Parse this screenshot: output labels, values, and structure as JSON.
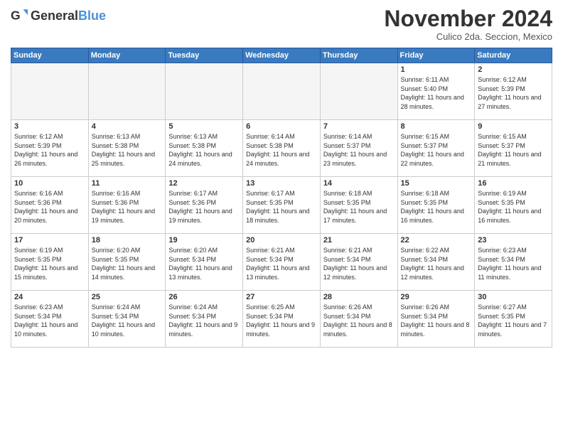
{
  "logo": {
    "general": "General",
    "blue": "Blue"
  },
  "title": "November 2024",
  "location": "Culico 2da. Seccion, Mexico",
  "days_header": [
    "Sunday",
    "Monday",
    "Tuesday",
    "Wednesday",
    "Thursday",
    "Friday",
    "Saturday"
  ],
  "weeks": [
    {
      "shaded": false,
      "days": [
        {
          "number": "",
          "empty": true
        },
        {
          "number": "",
          "empty": true
        },
        {
          "number": "",
          "empty": true
        },
        {
          "number": "",
          "empty": true
        },
        {
          "number": "",
          "empty": true
        },
        {
          "number": "1",
          "sunrise": "6:11 AM",
          "sunset": "5:40 PM",
          "daylight": "11 hours and 28 minutes."
        },
        {
          "number": "2",
          "sunrise": "6:12 AM",
          "sunset": "5:39 PM",
          "daylight": "11 hours and 27 minutes."
        }
      ]
    },
    {
      "shaded": false,
      "days": [
        {
          "number": "3",
          "sunrise": "6:12 AM",
          "sunset": "5:39 PM",
          "daylight": "11 hours and 26 minutes."
        },
        {
          "number": "4",
          "sunrise": "6:13 AM",
          "sunset": "5:38 PM",
          "daylight": "11 hours and 25 minutes."
        },
        {
          "number": "5",
          "sunrise": "6:13 AM",
          "sunset": "5:38 PM",
          "daylight": "11 hours and 24 minutes."
        },
        {
          "number": "6",
          "sunrise": "6:14 AM",
          "sunset": "5:38 PM",
          "daylight": "11 hours and 24 minutes."
        },
        {
          "number": "7",
          "sunrise": "6:14 AM",
          "sunset": "5:37 PM",
          "daylight": "11 hours and 23 minutes."
        },
        {
          "number": "8",
          "sunrise": "6:15 AM",
          "sunset": "5:37 PM",
          "daylight": "11 hours and 22 minutes."
        },
        {
          "number": "9",
          "sunrise": "6:15 AM",
          "sunset": "5:37 PM",
          "daylight": "11 hours and 21 minutes."
        }
      ]
    },
    {
      "shaded": true,
      "days": [
        {
          "number": "10",
          "sunrise": "6:16 AM",
          "sunset": "5:36 PM",
          "daylight": "11 hours and 20 minutes."
        },
        {
          "number": "11",
          "sunrise": "6:16 AM",
          "sunset": "5:36 PM",
          "daylight": "11 hours and 19 minutes."
        },
        {
          "number": "12",
          "sunrise": "6:17 AM",
          "sunset": "5:36 PM",
          "daylight": "11 hours and 19 minutes."
        },
        {
          "number": "13",
          "sunrise": "6:17 AM",
          "sunset": "5:35 PM",
          "daylight": "11 hours and 18 minutes."
        },
        {
          "number": "14",
          "sunrise": "6:18 AM",
          "sunset": "5:35 PM",
          "daylight": "11 hours and 17 minutes."
        },
        {
          "number": "15",
          "sunrise": "6:18 AM",
          "sunset": "5:35 PM",
          "daylight": "11 hours and 16 minutes."
        },
        {
          "number": "16",
          "sunrise": "6:19 AM",
          "sunset": "5:35 PM",
          "daylight": "11 hours and 16 minutes."
        }
      ]
    },
    {
      "shaded": false,
      "days": [
        {
          "number": "17",
          "sunrise": "6:19 AM",
          "sunset": "5:35 PM",
          "daylight": "11 hours and 15 minutes."
        },
        {
          "number": "18",
          "sunrise": "6:20 AM",
          "sunset": "5:35 PM",
          "daylight": "11 hours and 14 minutes."
        },
        {
          "number": "19",
          "sunrise": "6:20 AM",
          "sunset": "5:34 PM",
          "daylight": "11 hours and 13 minutes."
        },
        {
          "number": "20",
          "sunrise": "6:21 AM",
          "sunset": "5:34 PM",
          "daylight": "11 hours and 13 minutes."
        },
        {
          "number": "21",
          "sunrise": "6:21 AM",
          "sunset": "5:34 PM",
          "daylight": "11 hours and 12 minutes."
        },
        {
          "number": "22",
          "sunrise": "6:22 AM",
          "sunset": "5:34 PM",
          "daylight": "11 hours and 12 minutes."
        },
        {
          "number": "23",
          "sunrise": "6:23 AM",
          "sunset": "5:34 PM",
          "daylight": "11 hours and 11 minutes."
        }
      ]
    },
    {
      "shaded": true,
      "days": [
        {
          "number": "24",
          "sunrise": "6:23 AM",
          "sunset": "5:34 PM",
          "daylight": "11 hours and 10 minutes."
        },
        {
          "number": "25",
          "sunrise": "6:24 AM",
          "sunset": "5:34 PM",
          "daylight": "11 hours and 10 minutes."
        },
        {
          "number": "26",
          "sunrise": "6:24 AM",
          "sunset": "5:34 PM",
          "daylight": "11 hours and 9 minutes."
        },
        {
          "number": "27",
          "sunrise": "6:25 AM",
          "sunset": "5:34 PM",
          "daylight": "11 hours and 9 minutes."
        },
        {
          "number": "28",
          "sunrise": "6:26 AM",
          "sunset": "5:34 PM",
          "daylight": "11 hours and 8 minutes."
        },
        {
          "number": "29",
          "sunrise": "6:26 AM",
          "sunset": "5:34 PM",
          "daylight": "11 hours and 8 minutes."
        },
        {
          "number": "30",
          "sunrise": "6:27 AM",
          "sunset": "5:35 PM",
          "daylight": "11 hours and 7 minutes."
        }
      ]
    }
  ]
}
